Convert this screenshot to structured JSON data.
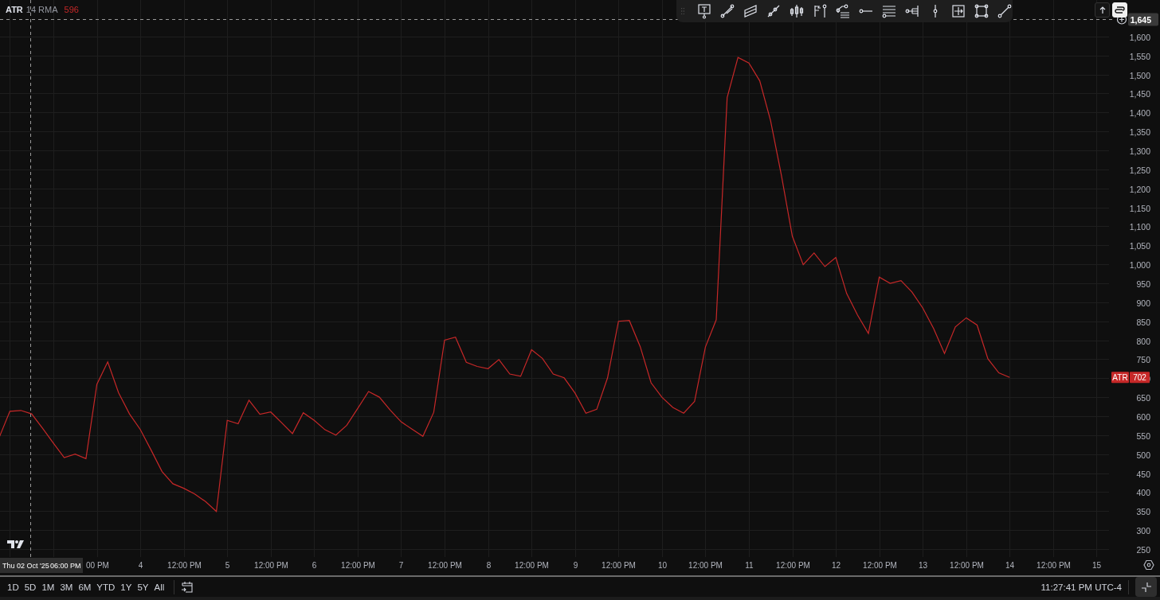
{
  "legend": {
    "name": "ATR",
    "params": "14 RMA",
    "value": "596"
  },
  "chart": {
    "chart_data": {
      "type": "line",
      "grid": true,
      "ylim": [
        229,
        1696
      ],
      "ref_lines": [
        {
          "axis": "y",
          "value": 1645,
          "label": "1,645"
        }
      ],
      "categories": [
        null,
        null,
        null,
        null,
        null,
        null,
        null,
        null,
        null,
        "00 PM",
        null,
        null,
        null,
        "4",
        null,
        null,
        null,
        "12:00 PM",
        null,
        null,
        null,
        "5",
        null,
        null,
        null,
        "12:00 PM",
        null,
        null,
        null,
        "6",
        null,
        null,
        null,
        "12:00 PM",
        null,
        null,
        null,
        "7",
        null,
        null,
        null,
        "12:00 PM",
        null,
        null,
        null,
        "8",
        null,
        null,
        null,
        "12:00 PM",
        null,
        null,
        null,
        "9",
        null,
        null,
        null,
        "12:00 PM",
        null,
        null,
        null,
        "10",
        null,
        null,
        null,
        "12:00 PM",
        null,
        null,
        null,
        "11",
        null,
        null,
        null,
        "12:00 PM",
        null,
        null,
        null,
        "12",
        null,
        null,
        null,
        "12:00 PM",
        null,
        null,
        null,
        "13",
        null,
        null,
        null,
        "12:00 PM",
        null,
        null,
        null,
        "14",
        null,
        null,
        null,
        "12:00 PM",
        null,
        null,
        null,
        "15"
      ],
      "yticks": [
        250,
        300,
        350,
        400,
        450,
        500,
        550,
        600,
        650,
        700,
        750,
        800,
        850,
        900,
        950,
        {
          "value": 1000,
          "label": "1,000"
        },
        {
          "value": 1050,
          "label": "1,050"
        },
        {
          "value": 1100,
          "label": "1,100"
        },
        {
          "value": 1150,
          "label": "1,150"
        },
        {
          "value": 1200,
          "label": "1,200"
        },
        {
          "value": 1250,
          "label": "1,250"
        },
        {
          "value": 1300,
          "label": "1,300"
        },
        {
          "value": 1350,
          "label": "1,350"
        },
        {
          "value": 1400,
          "label": "1,400"
        },
        {
          "value": 1450,
          "label": "1,450"
        },
        {
          "value": 1500,
          "label": "1,500"
        },
        {
          "value": 1550,
          "label": "1,550"
        },
        {
          "value": 1600,
          "label": "1,600"
        }
      ],
      "series": [
        {
          "name": "ATR",
          "color": "#c62828",
          "values": [
            543,
            613,
            615,
            606,
            568,
            529,
            491,
            500,
            488,
            684,
            743,
            662,
            606,
            565,
            510,
            454,
            422,
            410,
            395,
            375,
            349,
            589,
            580,
            642,
            605,
            611,
            583,
            554,
            609,
            589,
            564,
            550,
            576,
            620,
            665,
            650,
            616,
            585,
            566,
            547,
            610,
            800,
            808,
            742,
            731,
            725,
            749,
            711,
            705,
            775,
            752,
            711,
            701,
            661,
            608,
            618,
            701,
            850,
            852,
            783,
            688,
            650,
            623,
            608,
            639,
            782,
            854,
            1439,
            1545,
            1530,
            1483,
            1378,
            1233,
            1074,
            999,
            1030,
            994,
            1018,
            923,
            866,
            818,
            966,
            950,
            957,
            927,
            885,
            831,
            765,
            835,
            859,
            840,
            751,
            714,
            702,
            null,
            null,
            null,
            null,
            null,
            null,
            null,
            null
          ]
        }
      ]
    },
    "crosshair": {
      "date_label": "Thu 02 Oct '25",
      "time_label": "06:00 PM"
    },
    "last_value": {
      "value": "702"
    }
  },
  "range_bar": {
    "ranges": [
      {
        "label": "1D",
        "selected": false
      },
      {
        "label": "5D",
        "selected": false
      },
      {
        "label": "1M",
        "selected": false
      },
      {
        "label": "3M",
        "selected": false
      },
      {
        "label": "6M",
        "selected": false
      },
      {
        "label": "YTD",
        "selected": false
      },
      {
        "label": "1Y",
        "selected": false
      },
      {
        "label": "5Y",
        "selected": false
      },
      {
        "label": "All",
        "selected": false
      }
    ]
  },
  "clock": "11:27:41 PM UTC-4"
}
